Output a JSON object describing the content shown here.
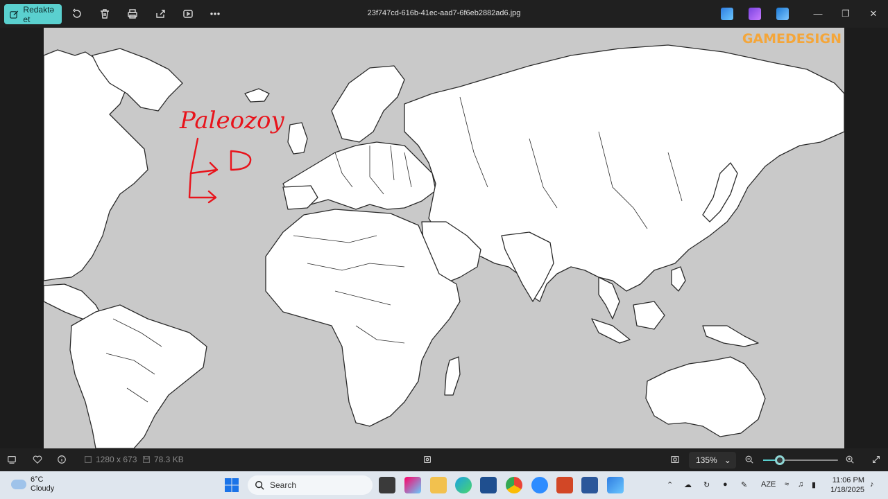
{
  "toolbar": {
    "edit_label": "Redaktə et",
    "filename": "23f747cd-616b-41ec-aad7-6f6eb2882ad6.jpg"
  },
  "image": {
    "watermark": "GAMEDESIGN",
    "handwriting": "Paleozoy"
  },
  "statusbar": {
    "dimensions": "1280 x 673",
    "filesize": "78.3 KB",
    "zoom": "135%",
    "zoom_fraction": 0.22
  },
  "taskbar": {
    "temperature": "6°C",
    "condition": "Cloudy",
    "search_placeholder": "Search",
    "language": "AZE",
    "time": "11:06 PM",
    "date": "1/18/2025"
  },
  "colors": {
    "accent": "#5ad0cf",
    "map_water": "#c9c9c9",
    "land": "#ffffff",
    "ink": "#e8141c",
    "watermark": "#f4a63a"
  }
}
